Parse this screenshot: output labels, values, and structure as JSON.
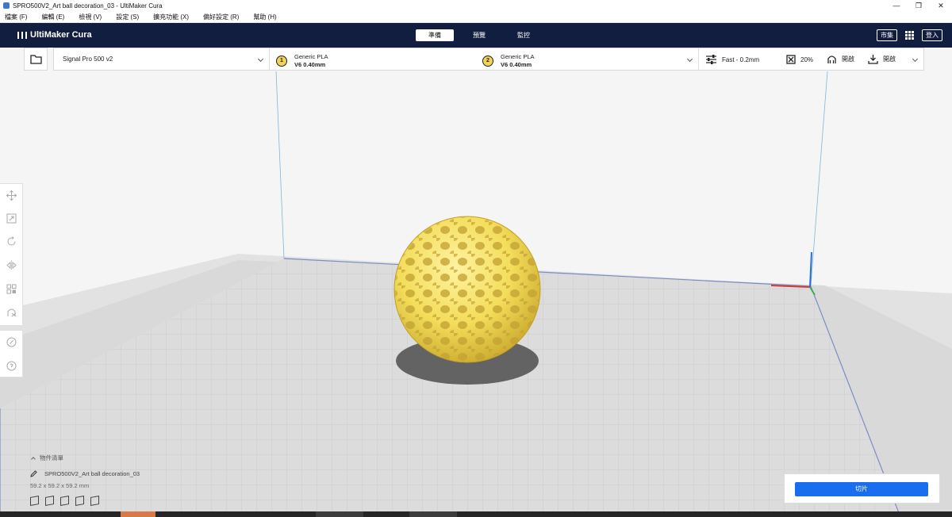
{
  "window": {
    "title": "SPRO500V2_Art ball decoration_03 - UltiMaker Cura",
    "controls": [
      "—",
      "❐",
      "✕"
    ]
  },
  "menu": [
    "檔案 (F)",
    "編輯 (E)",
    "檢視 (V)",
    "設定 (S)",
    "擴充功能 (X)",
    "偏好設定 (R)",
    "幫助 (H)"
  ],
  "header": {
    "logo": "UltiMaker Cura",
    "tabs": [
      {
        "label": "準備",
        "active": true
      },
      {
        "label": "預覽",
        "active": false
      },
      {
        "label": "監控",
        "active": false
      }
    ],
    "marketplace": "市集",
    "signin": "登入"
  },
  "toolbar": {
    "printer": "Signal Pro 500 v2",
    "extruders": [
      {
        "index": "1",
        "material": "Generic PLA",
        "nozzle": "V6 0.40mm"
      },
      {
        "index": "2",
        "material": "Generic PLA",
        "nozzle": "V6 0.40mm"
      }
    ],
    "profile": "Fast - 0.2mm",
    "infill": "20%",
    "support": "開啟",
    "adhesion": "開啟"
  },
  "objects": {
    "heading": "物件清單",
    "name": "SPRO500V2_Art ball decoration_03",
    "dimensions": "59.2 x 59.2 x 59.2 mm"
  },
  "slice": {
    "label": "切片"
  },
  "colors": {
    "header_bg": "#121e3f",
    "accent": "#196ef0",
    "model": "#f3dd5a",
    "extruder_badge": "#f1d35a"
  }
}
